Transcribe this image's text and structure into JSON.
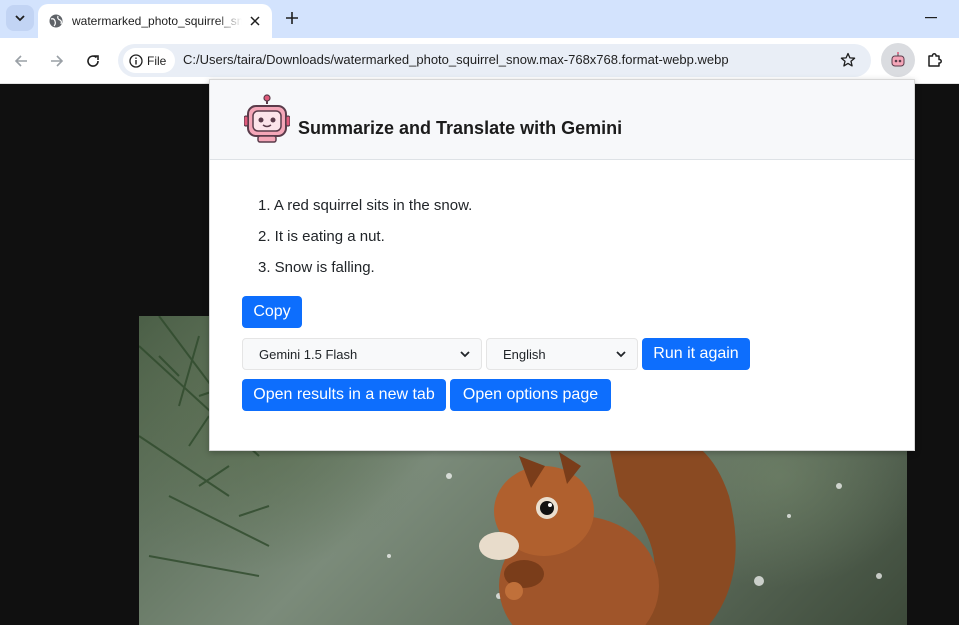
{
  "browser": {
    "tab": {
      "title": "watermarked_photo_squirrel_snow.max-768x768.format-webp.webp"
    },
    "address": {
      "chip_label": "File",
      "url": "C:/Users/taira/Downloads/watermarked_photo_squirrel_snow.max-768x768.format-webp.webp"
    },
    "accent_colors": {
      "tabstrip": "#d3e3fd",
      "omnibox": "#e9eef6"
    }
  },
  "popup": {
    "title": "Summarize and Translate with Gemini",
    "summary": [
      "1. A red squirrel sits in the snow.",
      "2. It is eating a nut.",
      "3. Snow is falling."
    ],
    "copy_label": "Copy",
    "model_select": {
      "value": "Gemini 1.5 Flash"
    },
    "language_select": {
      "value": "English"
    },
    "run_again_label": "Run it again",
    "open_new_tab_label": "Open results in a new tab",
    "open_options_label": "Open options page",
    "button_color": "#0d6efd"
  }
}
